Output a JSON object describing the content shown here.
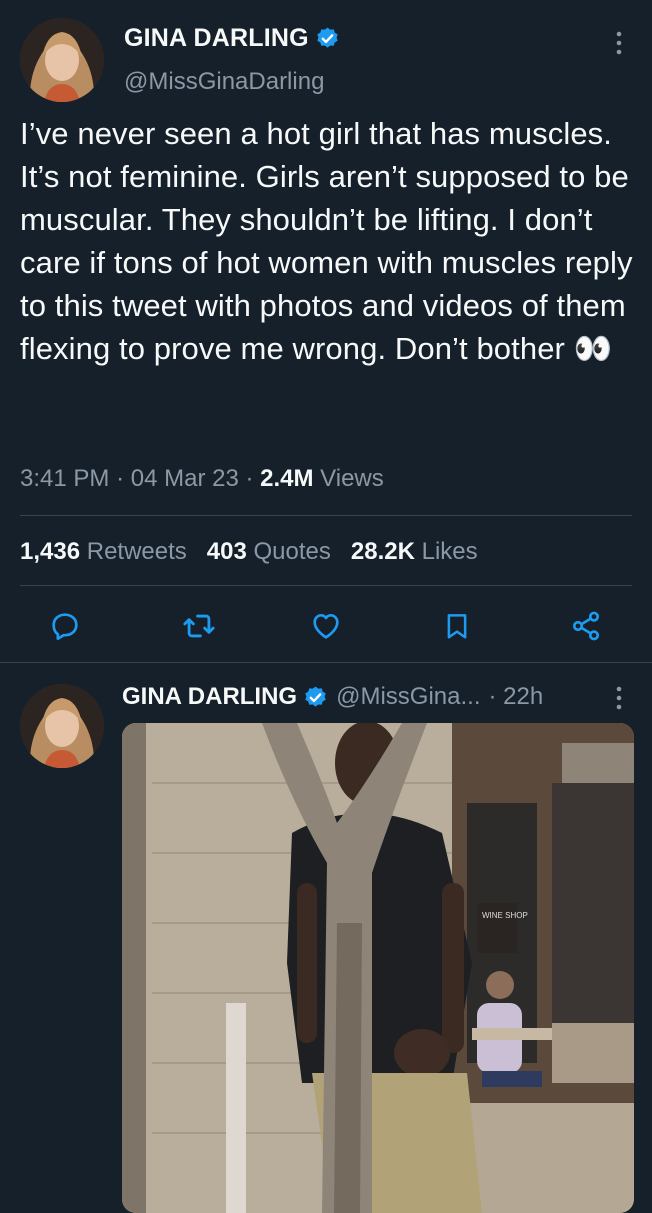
{
  "tweet": {
    "author": {
      "name": "GINA DARLING",
      "handle": "@MissGinaDarling",
      "verified": true
    },
    "text": "I’ve never seen a hot girl that has muscles. It’s not feminine. Girls aren’t supposed to be muscular. They shouldn’t be lifting. I don’t care if tons of hot women with muscles reply to this tweet with photos and videos of them flexing to prove me wrong. Don’t bother 👀",
    "time": "3:41 PM",
    "date": "04 Mar 23",
    "dot": "·",
    "views_count": "2.4M",
    "views_label": "Views"
  },
  "stats": {
    "retweets_count": "1,436",
    "retweets_label": "Retweets",
    "quotes_count": "403",
    "quotes_label": "Quotes",
    "likes_count": "28.2K",
    "likes_label": "Likes"
  },
  "actions": [
    "reply-icon",
    "retweet-icon",
    "like-icon",
    "bookmark-icon",
    "share-icon"
  ],
  "reply": {
    "author_name": "GINA DARLING",
    "handle_truncated": "@MissGina...",
    "time_ago": "· 22h",
    "media": {
      "type": "photo",
      "storefront_sign_text": "WINE SHOP"
    }
  },
  "colors": {
    "background": "#15202b",
    "text": "#f7f9f9",
    "muted": "#8b98a5",
    "divider": "#38444d",
    "verified": "#1d9bf0"
  }
}
